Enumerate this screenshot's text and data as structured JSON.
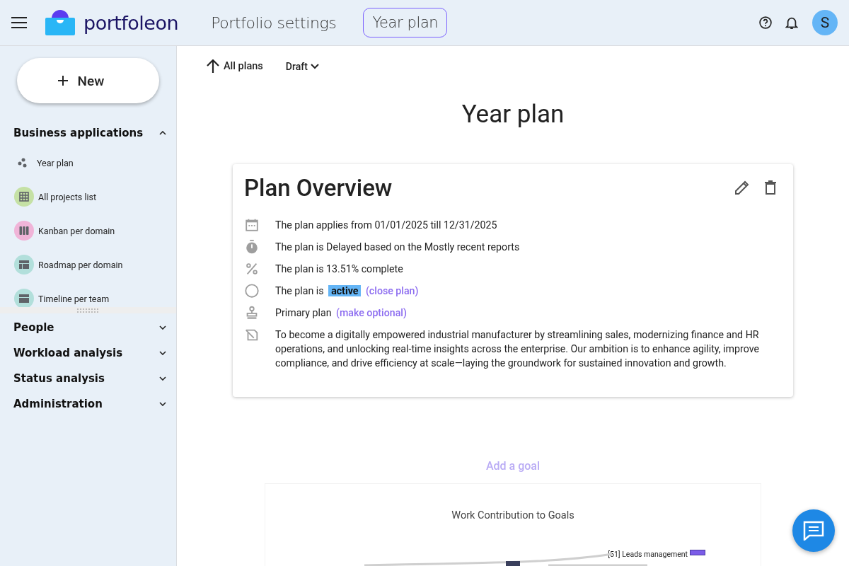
{
  "header": {
    "logo": "portfoleon",
    "nav_link": "Portfolio settings",
    "current_page": "Year plan",
    "avatar": "S"
  },
  "sidebar": {
    "new_button": "New",
    "sections": [
      {
        "label": "Business applications",
        "expanded": true,
        "items": [
          {
            "label": "Year plan",
            "kind": "dots"
          },
          {
            "label": "All projects list",
            "kind": "grid",
            "color": "#c5e1a5"
          },
          {
            "label": "Kanban per domain",
            "kind": "columns",
            "color": "#f0b4d8"
          },
          {
            "label": "Roadmap per domain",
            "kind": "roadmap",
            "color": "#b2dfdb"
          },
          {
            "label": "Timeline per team",
            "kind": "timeline",
            "color": "#b2dfdb"
          }
        ]
      },
      {
        "label": "People",
        "expanded": false
      },
      {
        "label": "Workload analysis",
        "expanded": false
      },
      {
        "label": "Status analysis",
        "expanded": false
      },
      {
        "label": "Administration",
        "expanded": false
      }
    ]
  },
  "toolbar": {
    "back_link": "All plans",
    "status_dropdown": "Draft"
  },
  "page_title": "Year plan",
  "overview": {
    "title": "Plan Overview",
    "rows": [
      {
        "kind": "dates",
        "text": "The plan applies from 01/01/2025 till 12/31/2025"
      },
      {
        "kind": "timer",
        "text": "The plan is Delayed based on the Mostly recent reports"
      },
      {
        "kind": "percent",
        "text": "The plan is 13.51% complete"
      },
      {
        "kind": "status",
        "text": "The plan is",
        "badge": "active",
        "link": "(close plan)"
      },
      {
        "kind": "primary",
        "text": "Primary plan",
        "link": "(make optional)"
      },
      {
        "kind": "vision",
        "text": "To become a digitally empowered industrial manufacturer by streamlining sales, modernizing finance and HR operations, and unlocking real-time insights across the enterprise. Our ambition is to enhance agility, improve compliance, and drive efficiency at scale—laying the groundwork for sustained innovation and growth."
      }
    ]
  },
  "add_goal": "Add a goal",
  "chart": {
    "title": "Work Contribution to Goals",
    "node_label": "[51] Leads management"
  }
}
